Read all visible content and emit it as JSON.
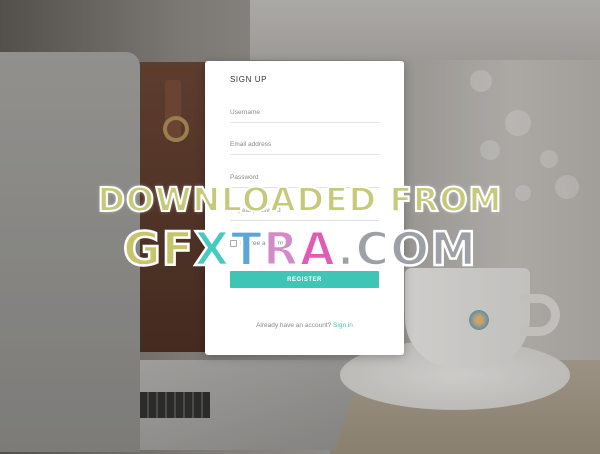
{
  "signup": {
    "title": "SIGN UP",
    "username_placeholder": "Username",
    "email_placeholder": "Email address",
    "password_placeholder": "Password",
    "confirm_placeholder": "Repeat password",
    "terms_label": "I agree all terms",
    "register_label": "REGISTER",
    "have_account_text": "Already have an account?",
    "signin_link": "Sign in"
  },
  "watermark": {
    "line1": "DOWNLOADED FROM",
    "line2_parts": [
      "G",
      "F",
      "X",
      "T",
      "R",
      "A",
      ".COM"
    ]
  },
  "colors": {
    "accent": "#3ec5b6",
    "card_bg": "#ffffff"
  },
  "icons": {
    "terms_checkbox": "checkbox-icon"
  }
}
